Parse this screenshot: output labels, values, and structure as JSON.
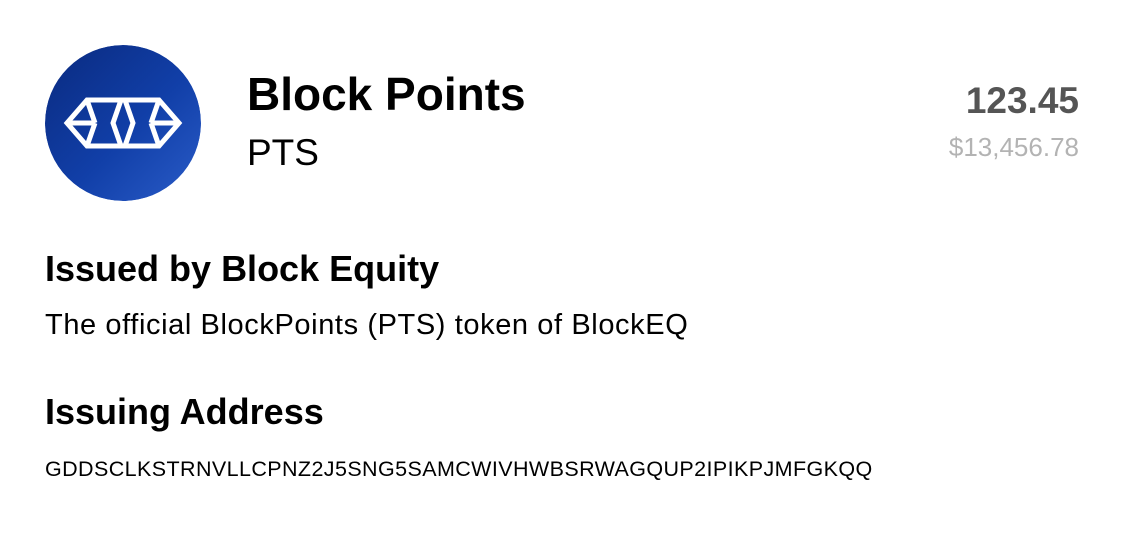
{
  "asset": {
    "name": "Block Points",
    "code": "PTS",
    "logo_icon": "block-points-logo-icon",
    "brand_colors": [
      "#0a2a7f",
      "#113fa8",
      "#2a5cc8"
    ]
  },
  "balance": {
    "amount": "123.45",
    "fiat": "$13,456.78"
  },
  "issuer": {
    "heading": "Issued by Block Equity",
    "description": "The official BlockPoints (PTS) token of BlockEQ"
  },
  "issuing_address": {
    "heading": "Issuing Address",
    "value": "GDDSCLKSTRNVLLCPNZ2J5SNG5SAMCWIVHWBSRWAGQUP2IPIKPJMFGKQQ"
  }
}
